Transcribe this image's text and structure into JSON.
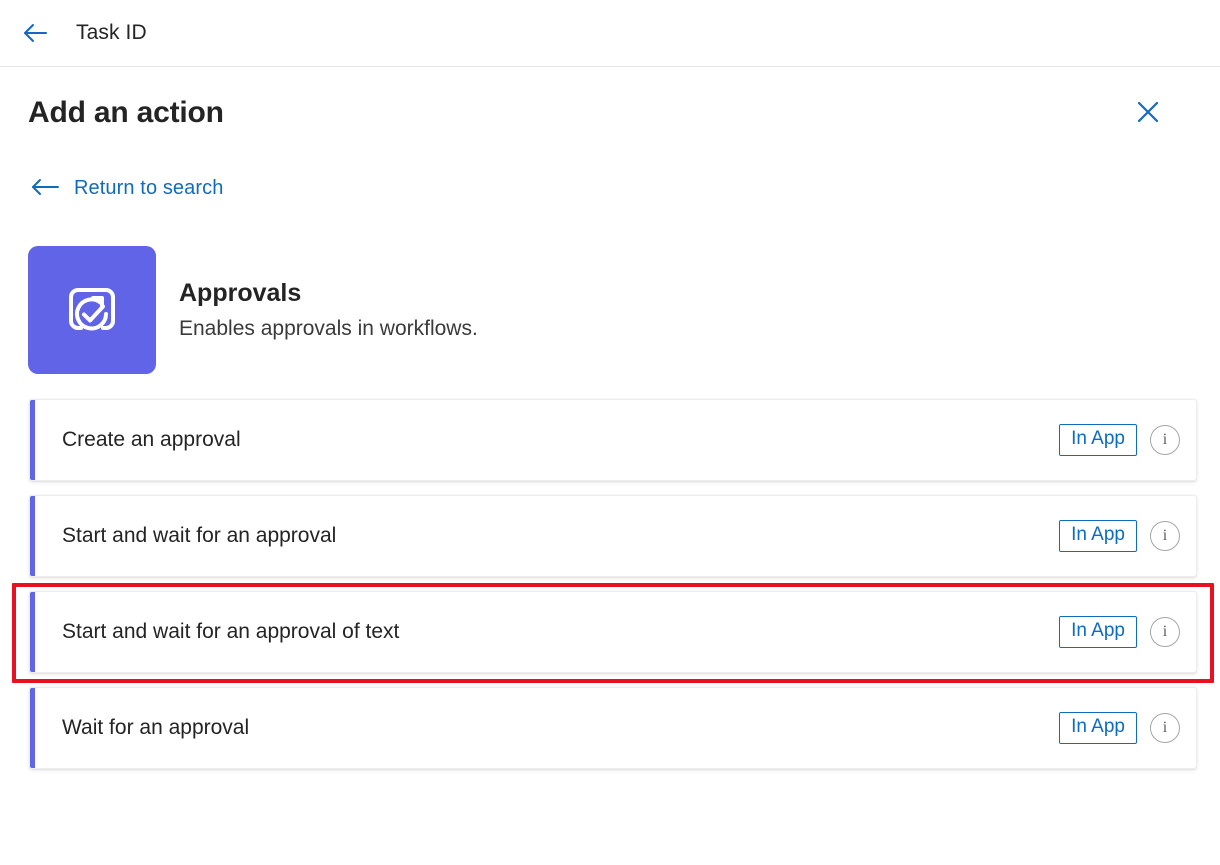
{
  "topbar": {
    "back_icon": "arrow-left-icon",
    "title": "Task ID"
  },
  "panel": {
    "title": "Add an action",
    "close_icon": "close-icon",
    "return_link": {
      "icon": "arrow-left-icon",
      "label": "Return to search"
    }
  },
  "connector": {
    "icon_name": "approvals-icon",
    "icon_bg": "#6264e8",
    "name": "Approvals",
    "description": "Enables approvals in workflows."
  },
  "actions": [
    {
      "label": "Create an approval",
      "badge": "In App",
      "info_icon": "info-icon",
      "accent": "#6264e8",
      "highlighted": false
    },
    {
      "label": "Start and wait for an approval",
      "badge": "In App",
      "info_icon": "info-icon",
      "accent": "#6264e8",
      "highlighted": false
    },
    {
      "label": "Start and wait for an approval of text",
      "badge": "In App",
      "info_icon": "info-icon",
      "accent": "#6264e8",
      "highlighted": true
    },
    {
      "label": "Wait for an approval",
      "badge": "In App",
      "info_icon": "info-icon",
      "accent": "#6264e8",
      "highlighted": false
    }
  ],
  "colors": {
    "link_blue": "#0f6cbd",
    "accent_purple": "#6264e8",
    "highlight_red": "#e81123",
    "text_dark": "#242424"
  }
}
